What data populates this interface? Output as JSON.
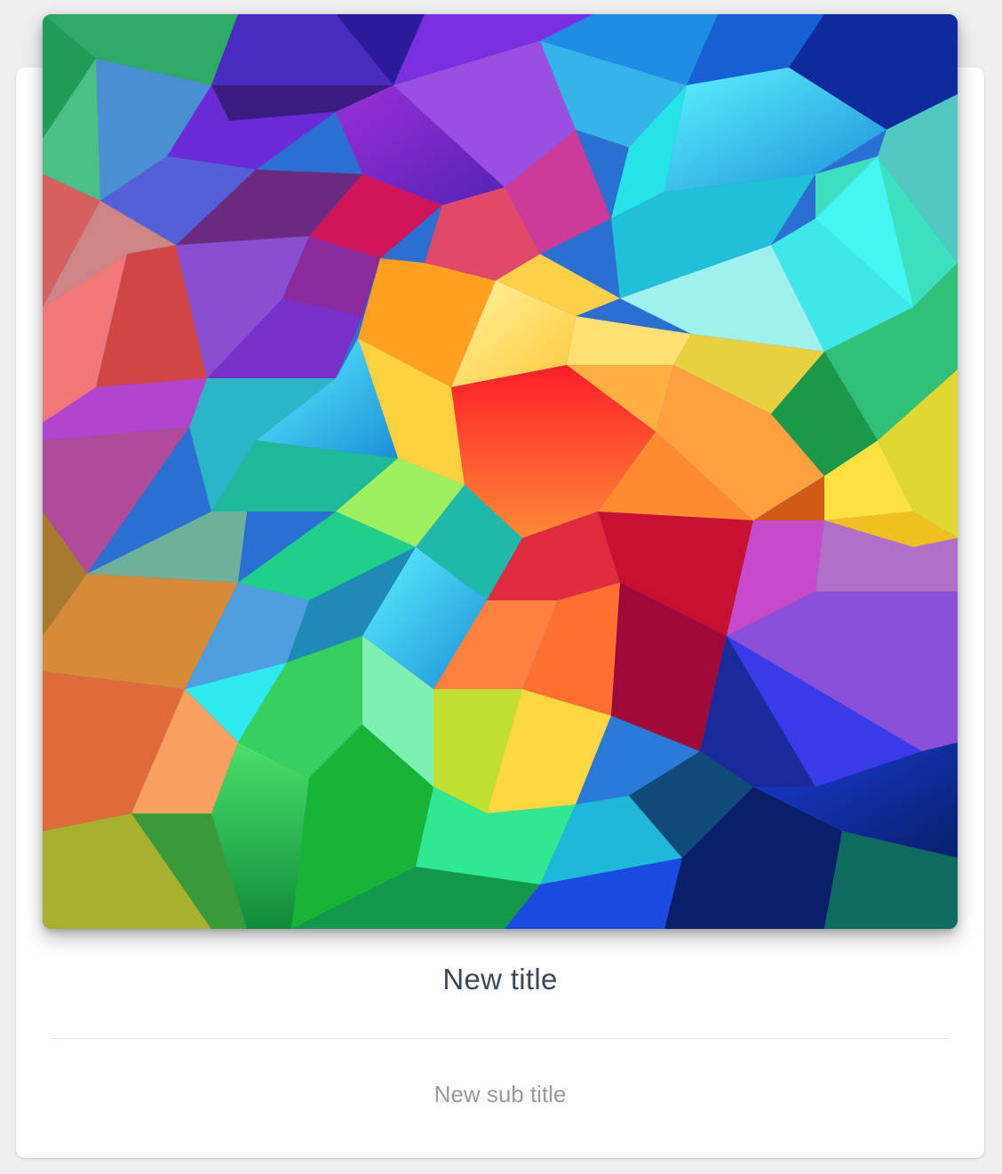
{
  "card": {
    "image_alt": "Colorful low-poly geometric background",
    "title": "New title",
    "subtitle": "New sub title"
  },
  "colors": {
    "title": "#3c4858",
    "subtitle": "#9a9a9a",
    "divider": "#e5e5e5",
    "card_background": "#ffffff",
    "page_background": "#efefef"
  }
}
